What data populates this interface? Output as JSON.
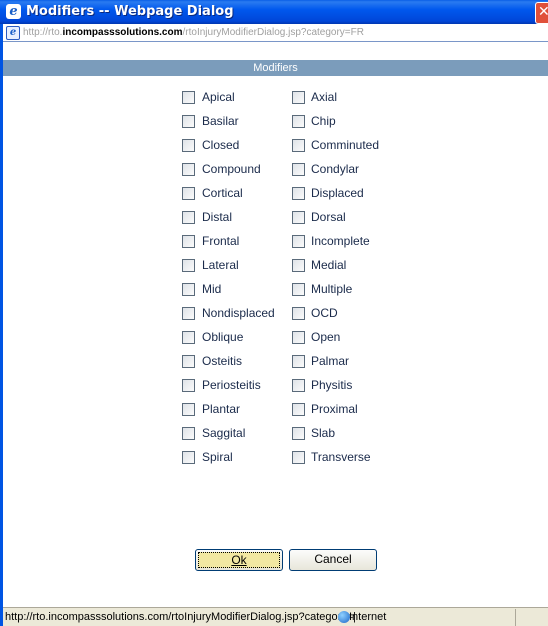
{
  "window": {
    "title": "Modifiers -- Webpage Dialog",
    "close_glyph": "✕"
  },
  "address": {
    "prefix": "http://rto.",
    "domain": "incompasssolutions.com",
    "path": "/rtoInjuryModifierDialog.jsp?category=FR"
  },
  "header": {
    "title": "Modifiers"
  },
  "modifiers": {
    "left": [
      "Apical",
      "Basilar",
      "Closed",
      "Compound",
      "Cortical",
      "Distal",
      "Frontal",
      "Lateral",
      "Mid",
      "Nondisplaced",
      "Oblique",
      "Osteitis",
      "Periosteitis",
      "Plantar",
      "Saggital",
      "Spiral"
    ],
    "right": [
      "Axial",
      "Chip",
      "Comminuted",
      "Condylar",
      "Displaced",
      "Dorsal",
      "Incomplete",
      "Medial",
      "Multiple",
      "OCD",
      "Open",
      "Palmar",
      "Physitis",
      "Proximal",
      "Slab",
      "Transverse"
    ]
  },
  "buttons": {
    "ok_label": "Ok",
    "cancel_label": "Cancel"
  },
  "status": {
    "url": "http://rto.incompasssolutions.com/rtoInjuryModifierDialog.jsp?category=|",
    "zone": "Internet"
  },
  "colors": {
    "titlebar": "#0054e3",
    "header_bar": "#7b9cbb",
    "focused_button": "#f2e8a2"
  },
  "icons": {
    "title": "ie-icon",
    "address": "ie-page-icon",
    "status": "globe-icon"
  }
}
